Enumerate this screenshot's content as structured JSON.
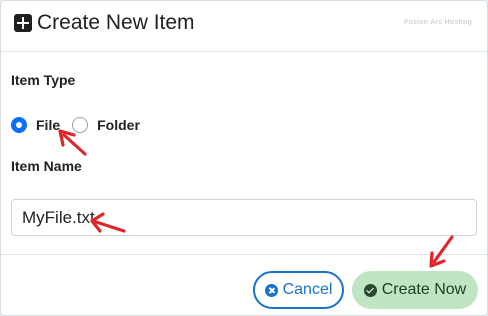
{
  "dialog": {
    "title": "Create New Item",
    "watermark": "Fusion Arc Hosting"
  },
  "form": {
    "item_type_label": "Item Type",
    "options": [
      {
        "label": "File",
        "checked": true
      },
      {
        "label": "Folder",
        "checked": false
      }
    ],
    "item_name_label": "Item Name",
    "item_name_value": "MyFile.txt"
  },
  "buttons": {
    "cancel_label": "Cancel",
    "create_label": "Create Now"
  },
  "colors": {
    "accent": "#0d6efd",
    "cancel": "#1a73c8",
    "create_bg": "#bfe5c3",
    "annotation_arrow": "#e0262b"
  }
}
